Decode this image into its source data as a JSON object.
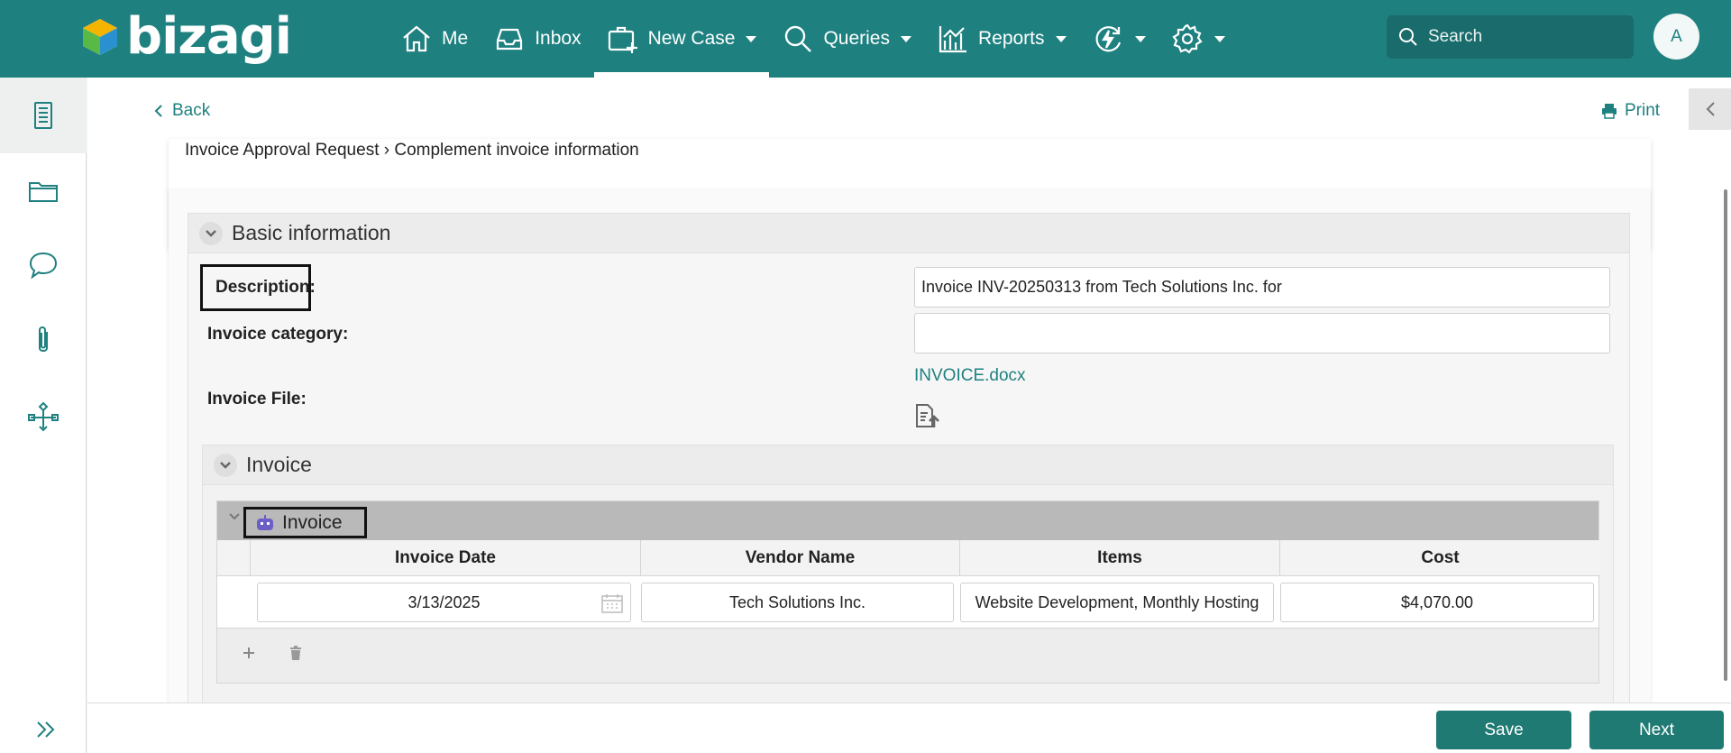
{
  "app": {
    "brand": "bizagi",
    "accent_color": "#1f8080"
  },
  "nav": {
    "items": [
      {
        "label": "Me",
        "icon": "home-icon"
      },
      {
        "label": "Inbox",
        "icon": "inbox-icon"
      },
      {
        "label": "New Case",
        "icon": "new-case-icon"
      },
      {
        "label": "Queries",
        "icon": "search-icon"
      },
      {
        "label": "Reports",
        "icon": "chart-icon"
      }
    ],
    "search_placeholder": "Search",
    "avatar_initial": "A"
  },
  "sidebar": {
    "items": [
      "form-icon",
      "folder-icon",
      "chat-icon",
      "paperclip-icon",
      "process-map-icon"
    ]
  },
  "page": {
    "back_label": "Back",
    "print_label": "Print",
    "breadcrumb": "Invoice Approval Request › Complement invoice information"
  },
  "form": {
    "basic_info_title": "Basic information",
    "description_label": "Description:",
    "description_value": "Invoice INV-20250313 from Tech Solutions Inc. for",
    "category_label": "Invoice category:",
    "category_value": "",
    "file_label": "Invoice File:",
    "file_name": "INVOICE.docx",
    "invoice_group_title": "Invoice",
    "grid_title": "Invoice",
    "columns": [
      "Invoice Date",
      "Vendor Name",
      "Items",
      "Cost"
    ],
    "rows": [
      {
        "date": "3/13/2025",
        "vendor": "Tech Solutions Inc.",
        "items": "Website Development, Monthly Hosting",
        "cost": "$4,070.00"
      }
    ]
  },
  "footer": {
    "save_label": "Save",
    "next_label": "Next"
  }
}
